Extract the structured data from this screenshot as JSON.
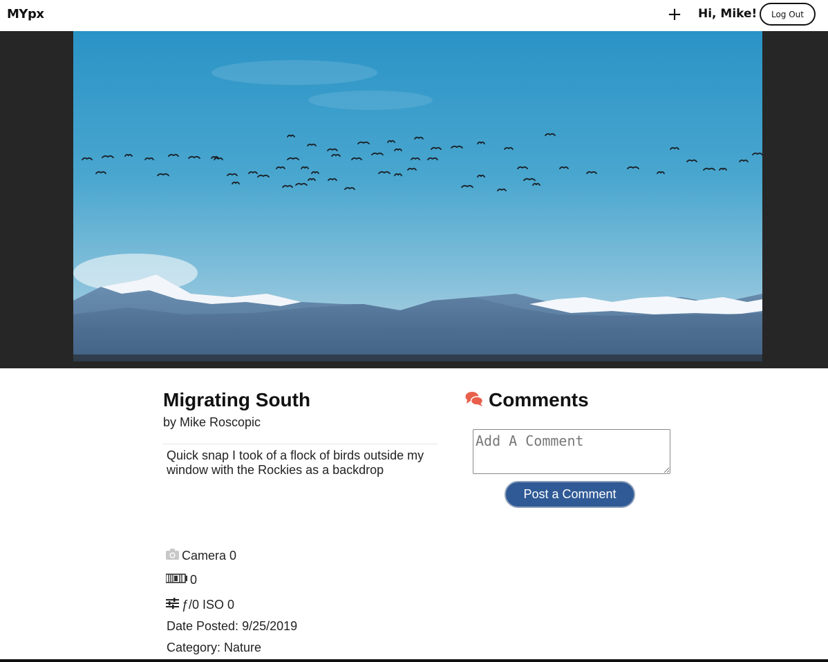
{
  "header": {
    "logo": "MYpx",
    "add_label": "+",
    "greeting": "Hi, Mike!",
    "logout_label": "Log Out"
  },
  "photo": {
    "subject": "flock of birds over snowy mountains"
  },
  "details": {
    "title": "Migrating South",
    "byline": "by Mike Roscopic",
    "description": "Quick snap I took of a flock of birds outside my window with the Rockies as a backdrop",
    "camera": "Camera 0",
    "lens": "0",
    "settings": "ƒ/0 ISO 0",
    "date_posted": "Date Posted: 9/25/2019",
    "category": "Category: Nature"
  },
  "comments": {
    "title": "Comments",
    "placeholder": "Add A Comment",
    "post_label": "Post a Comment"
  },
  "icons": {
    "comments": "comments-icon",
    "camera": "camera-icon",
    "lens": "lens-icon",
    "settings": "sliders-icon"
  },
  "colors": {
    "accent_comments": "#e8604c",
    "post_button": "#2f5a96",
    "photo_band": "#262626"
  }
}
